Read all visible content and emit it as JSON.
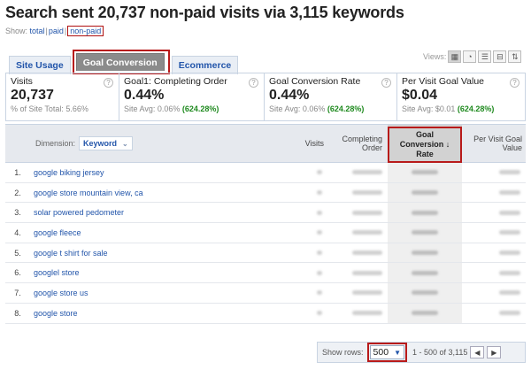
{
  "title": "Search sent 20,737 non-paid visits via 3,115 keywords",
  "show": {
    "label": "Show:",
    "total": "total",
    "paid": "paid",
    "nonpaid": "non-paid"
  },
  "tabs": [
    {
      "label": "Site Usage"
    },
    {
      "label": "Goal Conversion"
    },
    {
      "label": "Ecommerce"
    }
  ],
  "views_label": "Views:",
  "summary": [
    {
      "label": "Visits",
      "value": "20,737",
      "sub_prefix": "% of Site Total: ",
      "sub_value": "5.66%"
    },
    {
      "label": "Goal1: Completing Order",
      "value": "0.44%",
      "sub_prefix": "Site Avg: 0.06% ",
      "sub_value": "(624.28%)"
    },
    {
      "label": "Goal Conversion Rate",
      "value": "0.44%",
      "sub_prefix": "Site Avg: 0.06% ",
      "sub_value": "(624.28%)"
    },
    {
      "label": "Per Visit Goal Value",
      "value": "$0.04",
      "sub_prefix": "Site Avg: $0.01 ",
      "sub_value": "(624.28%)"
    }
  ],
  "table": {
    "dimension_label": "Dimension:",
    "dimension_value": "Keyword",
    "col_visits": "Visits",
    "col_order": "Completing Order",
    "col_rate": "Goal Conversion ↓ Rate",
    "col_pv": "Per Visit Goal Value",
    "rows": [
      {
        "num": "1.",
        "keyword": "google biking jersey"
      },
      {
        "num": "2.",
        "keyword": "google store mountain view, ca"
      },
      {
        "num": "3.",
        "keyword": "solar powered pedometer"
      },
      {
        "num": "4.",
        "keyword": "google fleece"
      },
      {
        "num": "5.",
        "keyword": "google t shirt for sale"
      },
      {
        "num": "6.",
        "keyword": "googlel store"
      },
      {
        "num": "7.",
        "keyword": "google store us"
      },
      {
        "num": "8.",
        "keyword": "google store"
      }
    ]
  },
  "pager": {
    "label": "Show rows:",
    "rows": "500",
    "range": "1 - 500 of 3,115"
  }
}
